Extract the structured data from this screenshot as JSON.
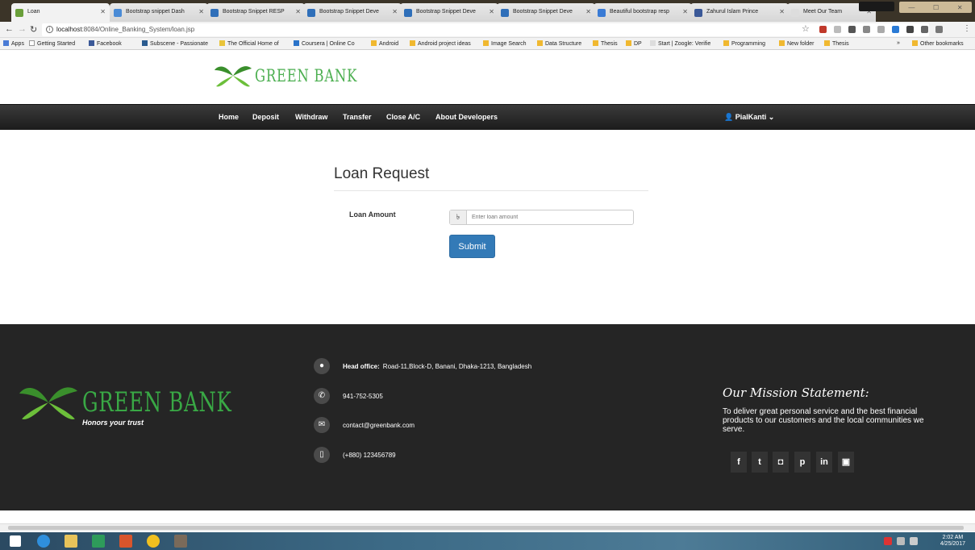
{
  "browser": {
    "tabs": [
      {
        "label": "Loan",
        "active": true
      },
      {
        "label": "Bootstrap snippet Dash"
      },
      {
        "label": "Bootstrap Snippet RESP"
      },
      {
        "label": "Bootstrap Snippet Deve"
      },
      {
        "label": "Bootstrap Snippet Deve"
      },
      {
        "label": "Bootstrap Snippet Deve"
      },
      {
        "label": "Beautiful bootstrap resp"
      },
      {
        "label": "Zahurul Islam Prince"
      },
      {
        "label": "Meet Our Team"
      }
    ],
    "url_host": "localhost",
    "url_path": ":8084/Online_Banking_System/loan.jsp",
    "bookmarks": [
      "Apps",
      "Getting Started",
      "Facebook",
      "Subscene - Passionate",
      "The Official Home of",
      "Coursera | Online Co",
      "Android",
      "Android project ideas",
      "Image Search",
      "Data Structure",
      "Thesis",
      "DP",
      "Start | Zoogle: Verifie",
      "Programming",
      "New folder",
      "Thesis",
      "»",
      "Other bookmarks"
    ]
  },
  "brand": {
    "name": "GREEN BANK",
    "tagline": "Honors your trust"
  },
  "nav": {
    "items": [
      "Home",
      "Deposit",
      "Withdraw",
      "Transfer",
      "Close A/C",
      "About Developers"
    ],
    "user": "PialKanti"
  },
  "form": {
    "title": "Loan Request",
    "amount_label": "Loan Amount",
    "currency_symbol": "৳",
    "amount_placeholder": "Enter loan amount",
    "submit_label": "Submit"
  },
  "footer": {
    "address_label": "Head office:",
    "address": "Road-11,Block-D, Banani, Dhaka-1213, Bangladesh",
    "phone": "941-752-5305",
    "email": "contact@greenbank.com",
    "mobile": "(+880) 123456789",
    "mission_title": "Our Mission Statement:",
    "mission_text": "To deliver great personal service and the best financial products to our customers and the local communities we serve.",
    "social": [
      {
        "icon": "facebook-icon",
        "glyph": "f"
      },
      {
        "icon": "twitter-icon",
        "glyph": "t"
      },
      {
        "icon": "instagram-icon",
        "glyph": "◘"
      },
      {
        "icon": "pinterest-icon",
        "glyph": "p"
      },
      {
        "icon": "linkedin-icon",
        "glyph": "in"
      },
      {
        "icon": "youtube-icon",
        "glyph": "▣"
      }
    ]
  },
  "taskbar": {
    "time": "2:02 AM",
    "date": "4/25/2017"
  },
  "colors": {
    "brand_green": "#4caf50",
    "primary": "#337ab7",
    "footer_bg": "#252525"
  }
}
